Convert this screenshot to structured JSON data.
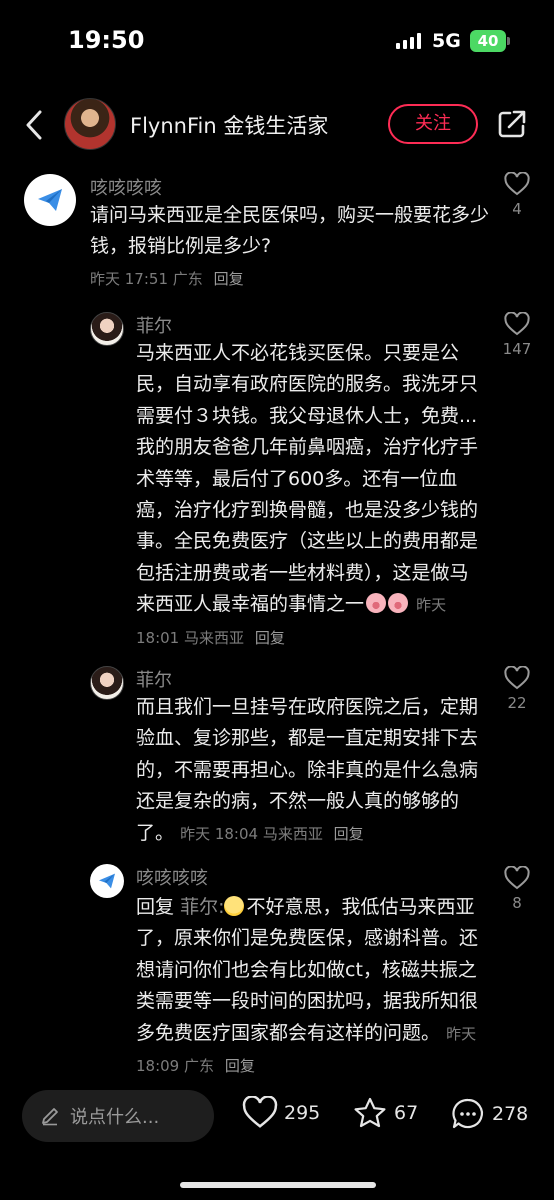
{
  "status_bar": {
    "time": "19:50",
    "network": "5G",
    "battery": "40"
  },
  "header": {
    "user_name": "FlynnFin 金钱生活家",
    "follow_label": "关注"
  },
  "comments": [
    {
      "name": "咳咳咳咳",
      "text": "请问马来西亚是全民医保吗，购买一般要花多少钱，报销比例是多少?",
      "time": "昨天 17:51",
      "location": "广东",
      "reply": "回复",
      "likes": "4"
    },
    {
      "name": "菲尔",
      "text": "马来西亚人不必花钱买医保。只要是公民，自动享有政府医院的服务。我洗牙只需要付３块钱。我父母退休人士，免费... 我的朋友爸爸几年前鼻咽癌，治疗化疗手术等等，最后付了600多。还有一位血癌，治疗化疗到换骨髓，也是没多少钱的事。全民免费医疗（这些以上的费用都是包括注册费或者一些材料费），这是做马来西亚人最幸福的事情之一",
      "time": "昨天 18:01",
      "location": "马来西亚",
      "reply": "回复",
      "likes": "147"
    },
    {
      "name": "菲尔",
      "text": "而且我们一旦挂号在政府医院之后，定期验血、复诊那些，都是一直定期安排下去的，不需要再担心。除非真的是什么急病还是复杂的病，不然一般人真的够够的了。",
      "time": "昨天 18:04",
      "location": "马来西亚",
      "reply": "回复",
      "likes": "22"
    },
    {
      "name": "咳咳咳咳",
      "reply_prefix": "回复",
      "reply_to": "菲尔:",
      "text": "不好意思，我低估马来西亚了，原来你们是免费医保，感谢科普。还想请问你们也会有比如做ct，核磁共振之类需要等一段时间的困扰吗，据我所知很多免费医疗国家都会有这样的问题。",
      "time": "昨天 18:09",
      "location": "广东",
      "reply": "回复",
      "likes": "8"
    }
  ],
  "bottom_bar": {
    "placeholder": "说点什么...",
    "likes": "295",
    "favorites": "67",
    "comments": "278"
  },
  "icons": {
    "back": "chevron-left-icon",
    "share": "share-icon",
    "like": "heart-icon",
    "favorite": "star-icon",
    "comment": "comment-bubble-icon",
    "edit": "pencil-icon",
    "avatar_plane": "paper-plane-icon"
  },
  "colors": {
    "accent": "#fe2c55",
    "background": "#000000"
  }
}
